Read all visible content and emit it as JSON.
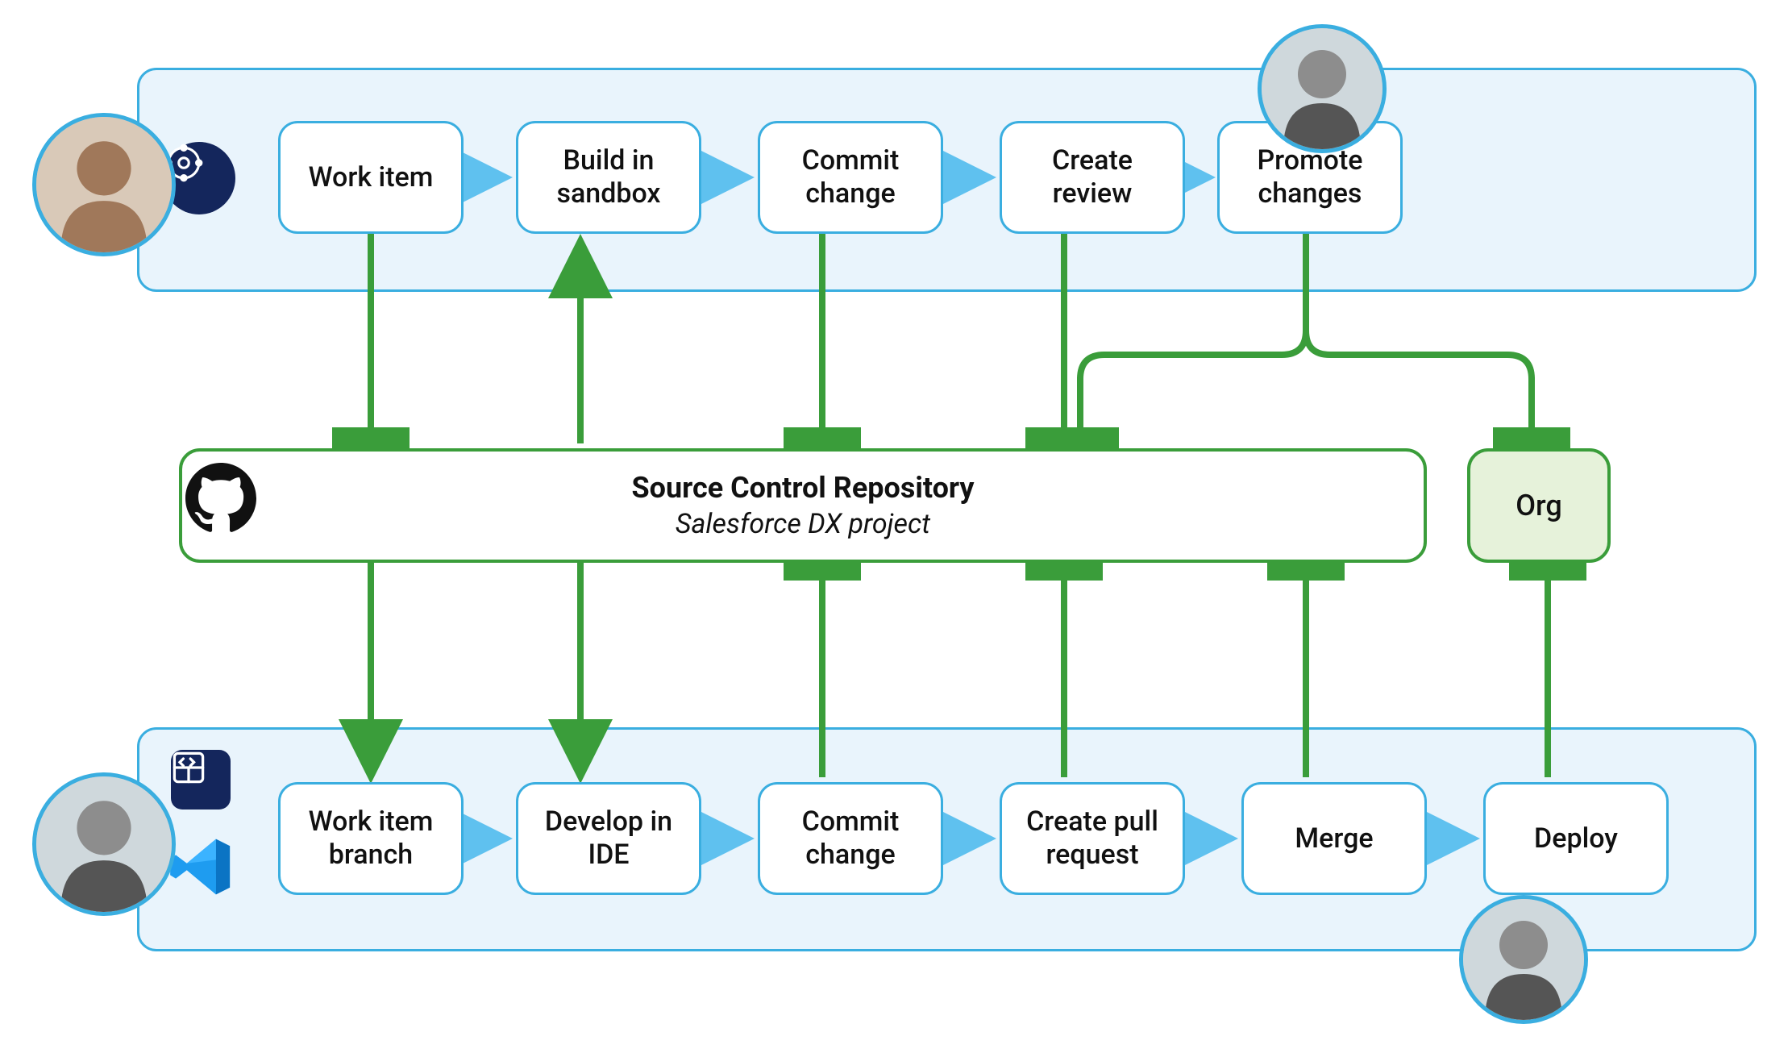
{
  "topLane": {
    "steps": [
      "Work item",
      "Build in sandbox",
      "Commit change",
      "Create review",
      "Promote changes"
    ]
  },
  "bottomLane": {
    "steps": [
      "Work item branch",
      "Develop in IDE",
      "Commit change",
      "Create pull request",
      "Merge",
      "Deploy"
    ]
  },
  "repo": {
    "title": "Source Control Repository",
    "subtitle": "Salesforce DX project"
  },
  "org": {
    "label": "Org"
  },
  "icons": {
    "devops": "devops-center-icon",
    "code": "code-panel-icon",
    "vscode": "vscode-icon",
    "github": "github-icon"
  },
  "colors": {
    "laneBorder": "#3aaee0",
    "laneFill": "#e9f4fc",
    "green": "#3a9d3a",
    "arrowBlue": "#5fc1ef"
  }
}
